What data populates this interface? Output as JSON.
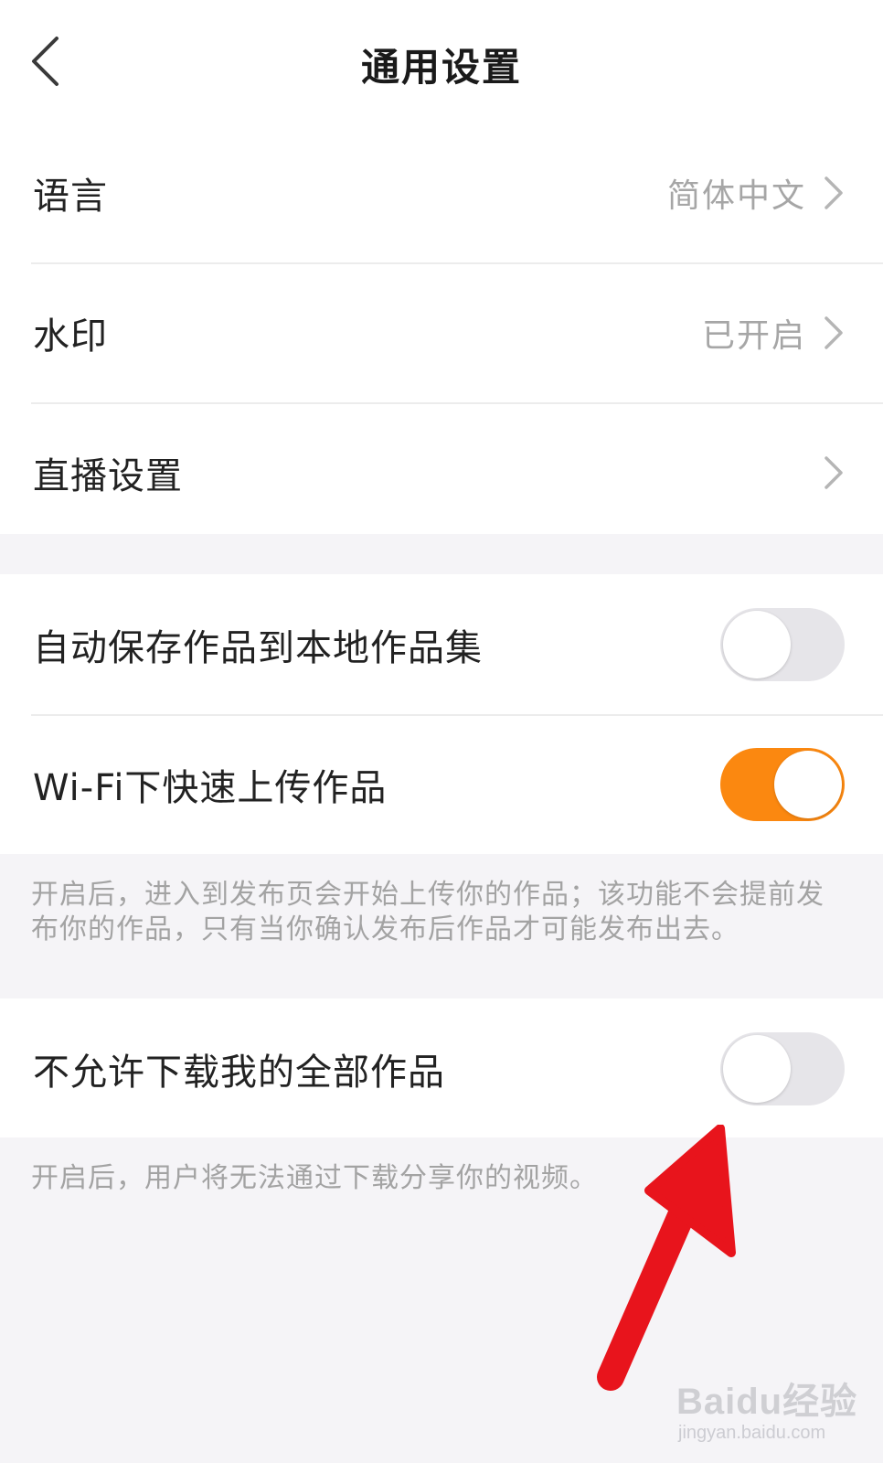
{
  "header": {
    "title": "通用设置",
    "back_icon": "chevron-left-icon"
  },
  "group1": {
    "items": [
      {
        "label": "语言",
        "value": "简体中文"
      },
      {
        "label": "水印",
        "value": "已开启"
      },
      {
        "label": "直播设置",
        "value": ""
      }
    ]
  },
  "group2": {
    "items": [
      {
        "label": "自动保存作品到本地作品集",
        "toggle": false
      },
      {
        "label": "Wi-Fi下快速上传作品",
        "toggle": true
      }
    ],
    "note": "开启后，进入到发布页会开始上传你的作品；该功能不会提前发布你的作品，只有当你确认发布后作品才可能发布出去。"
  },
  "group3": {
    "items": [
      {
        "label": "不允许下载我的全部作品",
        "toggle": false
      }
    ],
    "note": "开启后，用户将无法通过下载分享你的视频。"
  },
  "colors": {
    "toggle_on": "#fb8810",
    "toggle_off": "#e6e5e9",
    "annotation_arrow": "#e8141c"
  },
  "watermark": {
    "brand": "Baidu经验",
    "url": "jingyan.baidu.com"
  }
}
